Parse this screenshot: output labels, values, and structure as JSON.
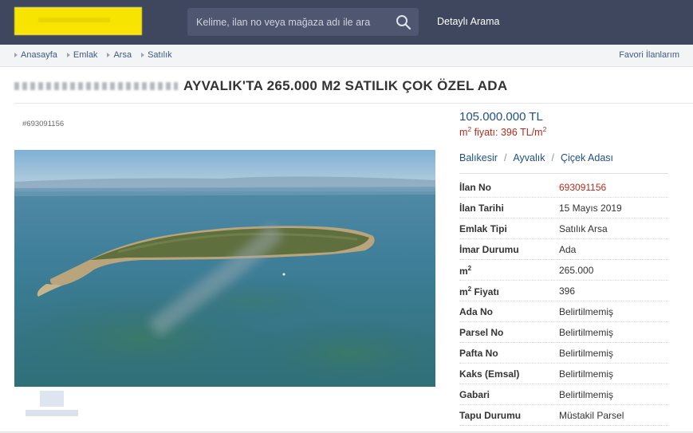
{
  "header": {
    "search_placeholder": "Kelime, ilan no veya mağaza adı ile ara",
    "advanced_search": "Detaylı Arama"
  },
  "breadcrumb": {
    "items": [
      "Anasayfa",
      "Emlak",
      "Arsa",
      "Satılık"
    ],
    "favorites": "Favori İlanlarım"
  },
  "listing": {
    "title": "AYVALIK'TA 265.000 M2 SATILIK ÇOK ÖZEL ADA",
    "ad_id_small": "#693091156",
    "price": "105.000.000 TL",
    "sqm_price_label": "m",
    "sqm_price_sup": "2",
    "sqm_price_mid": " fiyatı: 396 TL/m",
    "sqm_price_sup2": "2",
    "location": {
      "city": "Balıkesir",
      "district": "Ayvalık",
      "neighborhood": "Çiçek Adası"
    },
    "details": [
      {
        "key": "İlan No",
        "value": "693091156"
      },
      {
        "key": "İlan Tarihi",
        "value": "15 Mayıs 2019"
      },
      {
        "key": "Emlak Tipi",
        "value": "Satılık Arsa"
      },
      {
        "key": "İmar Durumu",
        "value": "Ada"
      },
      {
        "key": "m",
        "key_sup": "2",
        "value": "265.000"
      },
      {
        "key": "m",
        "key_sup": "2",
        "key_suffix": " Fiyatı",
        "value": "396"
      },
      {
        "key": "Ada No",
        "value": "Belirtilmemiş"
      },
      {
        "key": "Parsel No",
        "value": "Belirtilmemiş"
      },
      {
        "key": "Pafta No",
        "value": "Belirtilmemiş"
      },
      {
        "key": "Kaks (Emsal)",
        "value": "Belirtilmemiş"
      },
      {
        "key": "Gabari",
        "value": "Belirtilmemiş"
      },
      {
        "key": "Tapu Durumu",
        "value": "Müstakil Parsel"
      }
    ]
  },
  "colors": {
    "header_bg": "#3f475f",
    "price_blue": "#1f4f86",
    "accent_red": "#b22b1f",
    "logo_yellow": "#f7e400"
  }
}
